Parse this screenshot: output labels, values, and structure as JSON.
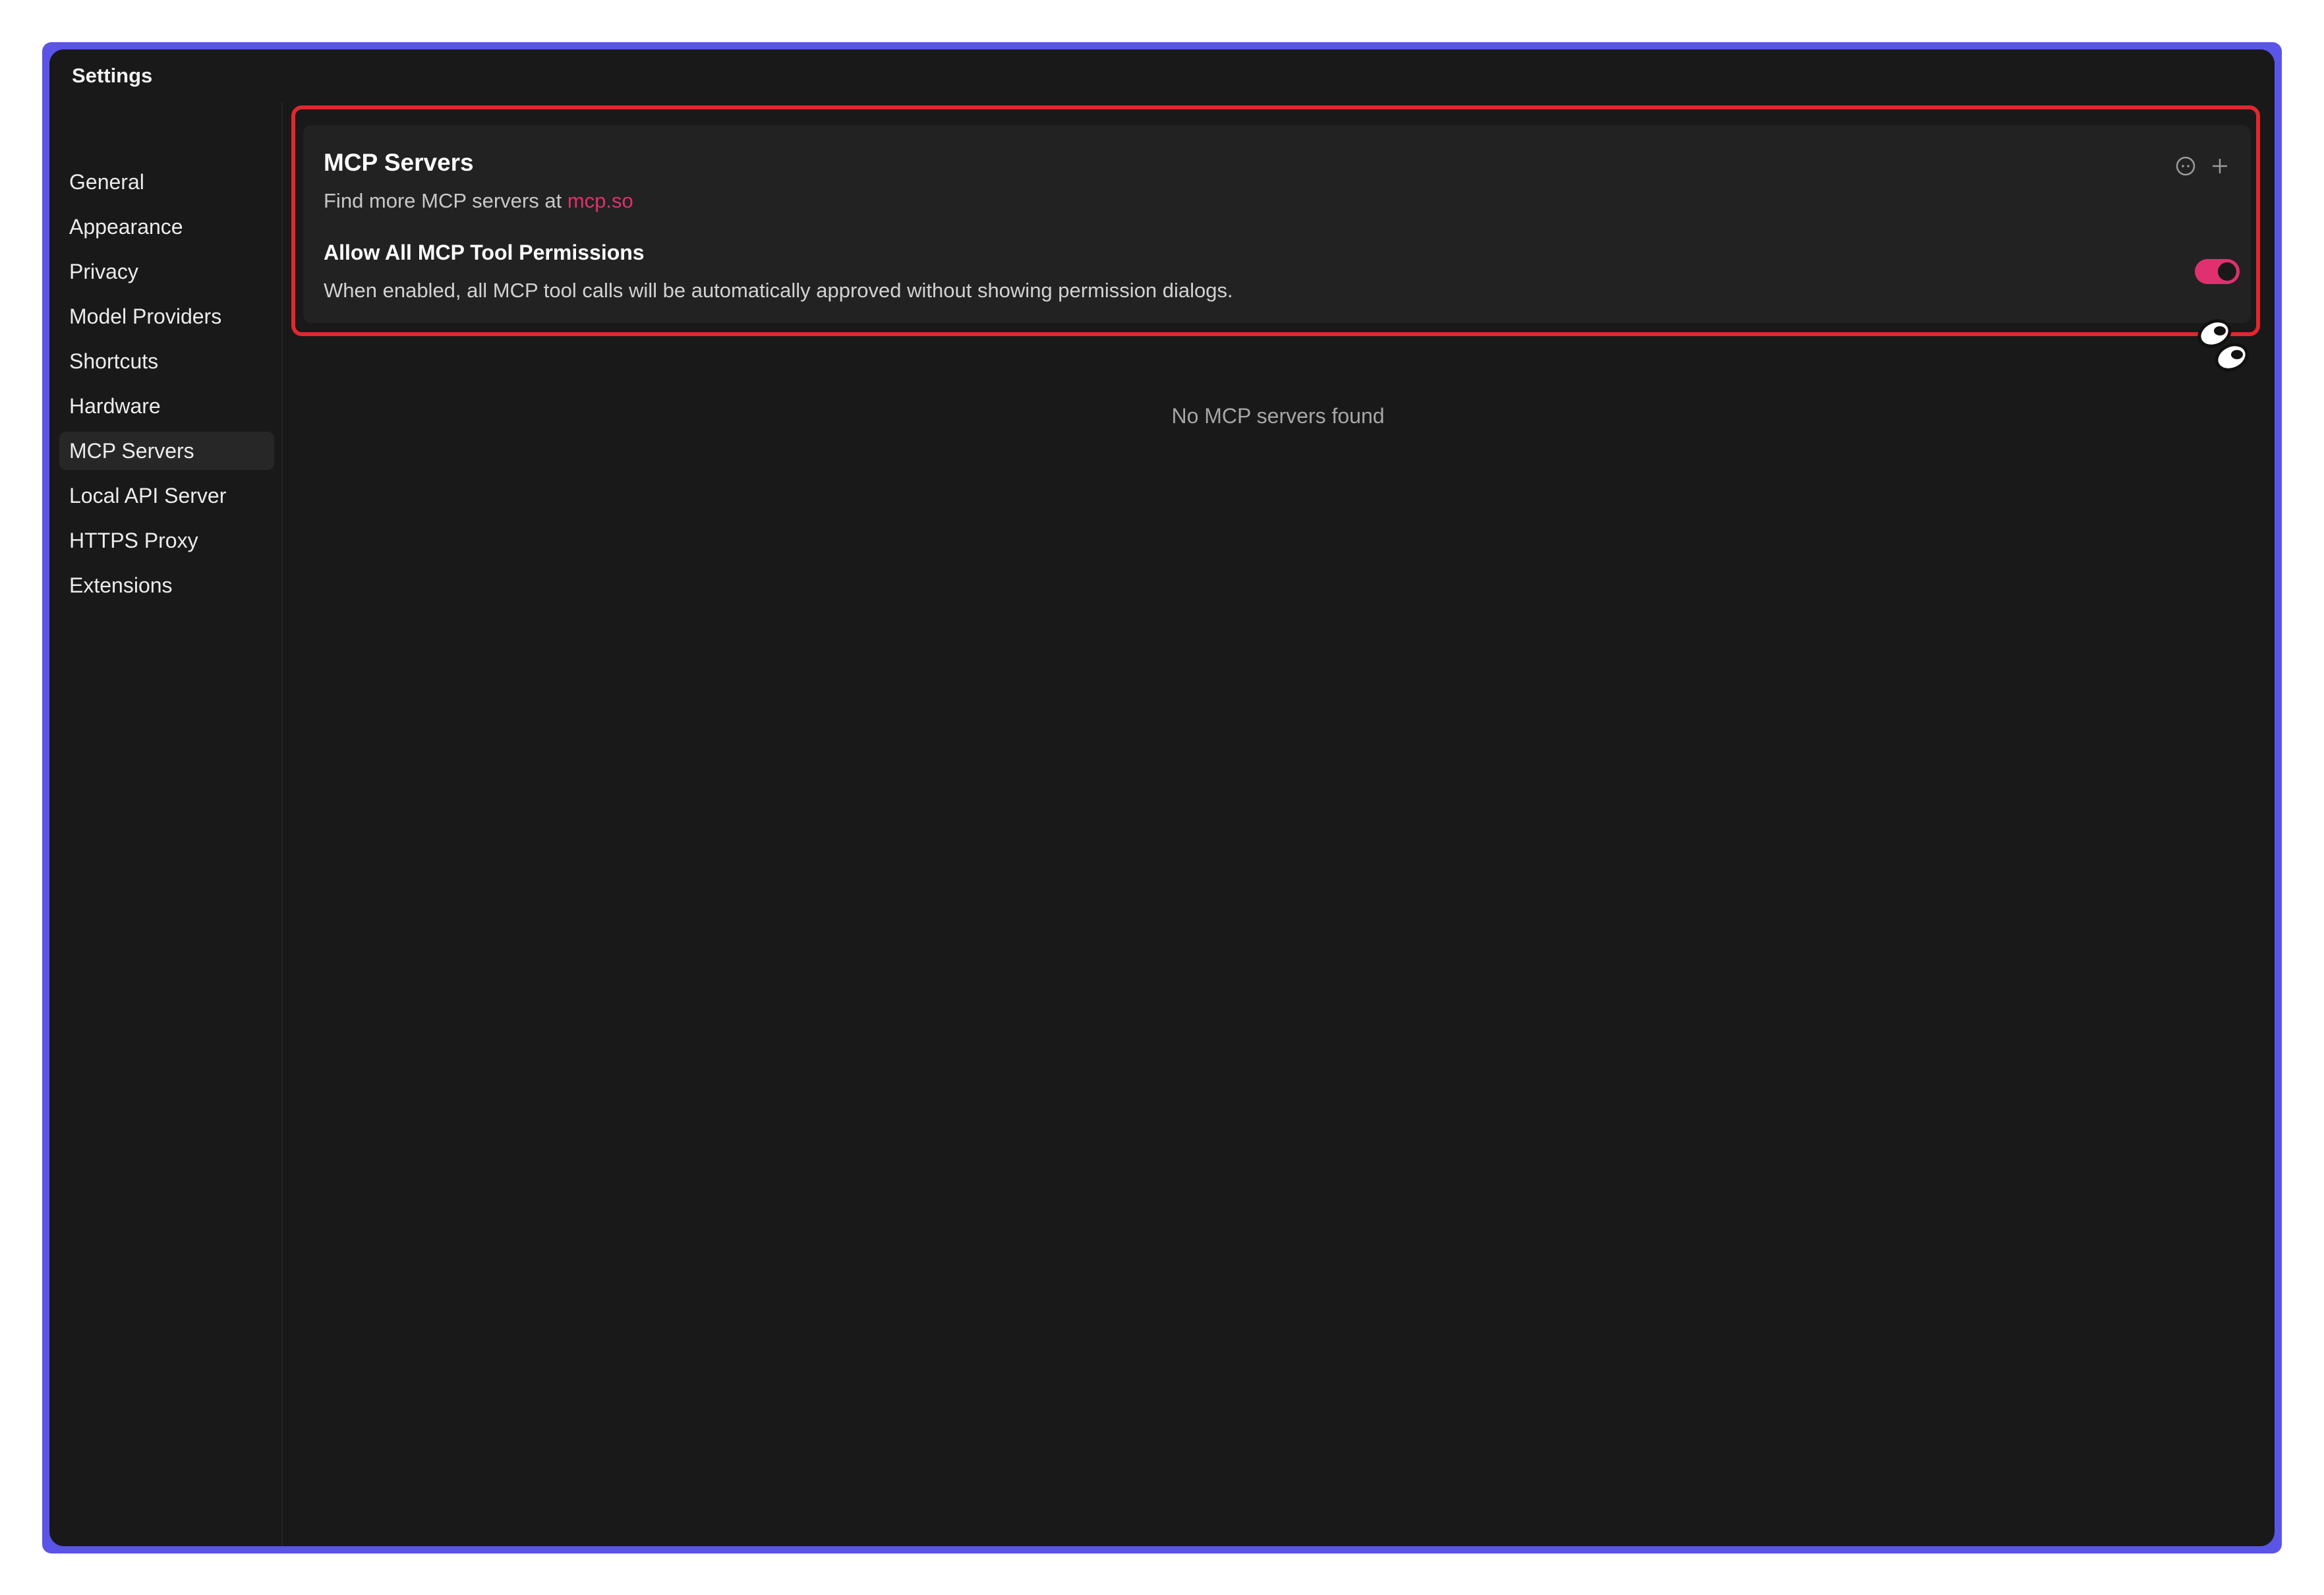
{
  "window": {
    "title": "Settings"
  },
  "sidebar": {
    "items": [
      {
        "label": "General"
      },
      {
        "label": "Appearance"
      },
      {
        "label": "Privacy"
      },
      {
        "label": "Model Providers"
      },
      {
        "label": "Shortcuts"
      },
      {
        "label": "Hardware"
      },
      {
        "label": "MCP Servers",
        "active": true
      },
      {
        "label": "Local API Server"
      },
      {
        "label": "HTTPS Proxy"
      },
      {
        "label": "Extensions"
      }
    ]
  },
  "mcp_card": {
    "title": "MCP Servers",
    "subtitle_prefix": "Find more MCP servers at ",
    "subtitle_link": "mcp.so",
    "icons": [
      "info-icon",
      "plus-icon"
    ],
    "permission_title": "Allow All MCP Tool Permissions",
    "permission_desc": "When enabled, all MCP tool calls will be automatically approved without showing permission dialogs.",
    "permission_enabled": true
  },
  "empty_state": "No MCP servers found",
  "colors": {
    "accent": "#e0306f",
    "frame": "#5a55e6",
    "highlight": "#e0282e",
    "background": "#191919"
  }
}
